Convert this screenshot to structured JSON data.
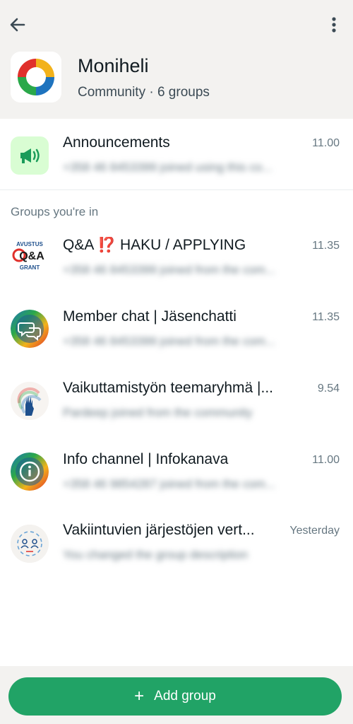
{
  "community": {
    "name": "Moniheli",
    "subtitle": "Community · 6 groups"
  },
  "announcements": {
    "title": "Announcements",
    "time": "11.00",
    "preview": "+358 46 8453399 joined using this co..."
  },
  "section_label": "Groups you're in",
  "groups": [
    {
      "title": "Q&A ⁉️ HAKU / APPLYING",
      "time": "11.35",
      "preview": "+358 46 8453399 joined from the com...",
      "avatar_text": [
        "AVUSTUS",
        "Q&A",
        "GRANT"
      ]
    },
    {
      "title": "Member chat | Jäsenchatti",
      "time": "11.35",
      "preview": "+358 46 8453399 joined from the com..."
    },
    {
      "title": "Vaikuttamistyön teemaryhmä |...",
      "time": "9.54",
      "preview": "Pardeep joined from the community"
    },
    {
      "title": "Info channel | Infokanava",
      "time": "11.00",
      "preview": "+358 46 9854287 joined from the com..."
    },
    {
      "title": "Vakiintuvien järjestöjen vert...",
      "time": "Yesterday",
      "preview": "You changed the group description"
    }
  ],
  "add_group": {
    "plus": "+",
    "label": "Add group"
  },
  "colors": {
    "header_bg": "#f3f2f0",
    "accent_green": "#21a366",
    "announce_bg": "#d9fdd3",
    "announce_icon": "#1a9c5a"
  }
}
